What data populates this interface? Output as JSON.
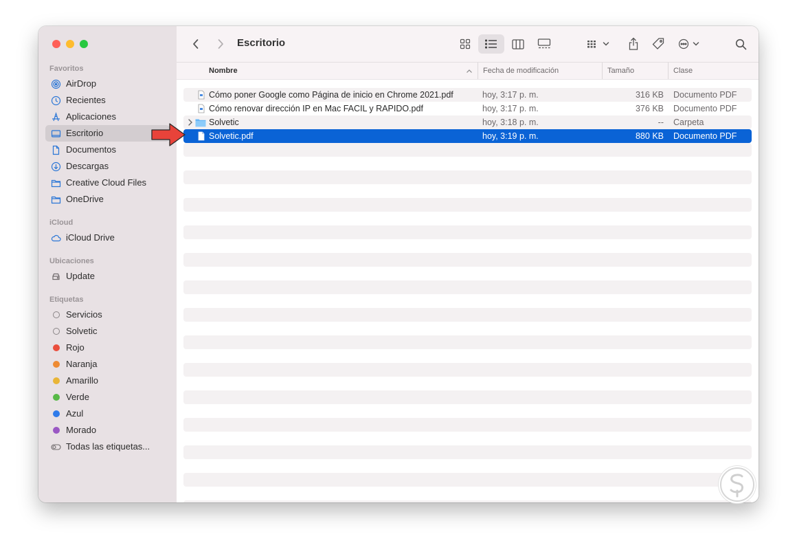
{
  "window": {
    "traffic_lights": {
      "close": "#fe5f57",
      "minimize": "#febc2e",
      "zoom": "#28c840"
    }
  },
  "sidebar": {
    "favorites_heading": "Favoritos",
    "favorites": [
      {
        "label": "AirDrop",
        "icon": "airdrop-icon"
      },
      {
        "label": "Recientes",
        "icon": "clock-icon"
      },
      {
        "label": "Aplicaciones",
        "icon": "applications-icon"
      },
      {
        "label": "Escritorio",
        "icon": "desktop-icon",
        "selected": true
      },
      {
        "label": "Documentos",
        "icon": "document-icon"
      },
      {
        "label": "Descargas",
        "icon": "download-icon"
      },
      {
        "label": "Creative Cloud Files",
        "icon": "folder-icon"
      },
      {
        "label": "OneDrive",
        "icon": "folder-icon"
      }
    ],
    "icloud_heading": "iCloud",
    "icloud": [
      {
        "label": "iCloud Drive",
        "icon": "cloud-icon"
      }
    ],
    "locations_heading": "Ubicaciones",
    "locations": [
      {
        "label": "Update",
        "icon": "disk-icon"
      }
    ],
    "tags_heading": "Etiquetas",
    "tags": [
      {
        "label": "Servicios",
        "color": ""
      },
      {
        "label": "Solvetic",
        "color": ""
      },
      {
        "label": "Rojo",
        "color": "#ea4e3d"
      },
      {
        "label": "Naranja",
        "color": "#ee8a33"
      },
      {
        "label": "Amarillo",
        "color": "#e9b537"
      },
      {
        "label": "Verde",
        "color": "#58b947"
      },
      {
        "label": "Azul",
        "color": "#2f7bea"
      },
      {
        "label": "Morado",
        "color": "#9a58c4"
      },
      {
        "label": "Todas las etiquetas...",
        "color": "all"
      }
    ]
  },
  "toolbar": {
    "title": "Escritorio",
    "back_icon": "chevron-left-icon",
    "forward_icon": "chevron-right-icon",
    "views": [
      "icon-view-icon",
      "list-view-icon",
      "column-view-icon",
      "gallery-view-icon"
    ],
    "active_view": "list-view-icon"
  },
  "columns": {
    "name": "Nombre",
    "date": "Fecha de modificación",
    "size": "Tamaño",
    "kind": "Clase"
  },
  "files": [
    {
      "name": "Cómo poner Google como Página de inicio en Chrome 2021.pdf",
      "date": "hoy, 3:17 p. m.",
      "size": "316 KB",
      "kind": "Documento PDF",
      "type": "pdf"
    },
    {
      "name": "Cómo renovar dirección IP en Mac  FACIL y RAPIDO.pdf",
      "date": "hoy, 3:17 p. m.",
      "size": "376 KB",
      "kind": "Documento PDF",
      "type": "pdf"
    },
    {
      "name": "Solvetic",
      "date": "hoy, 3:18 p. m.",
      "size": "--",
      "kind": "Carpeta",
      "type": "folder"
    },
    {
      "name": "Solvetic.pdf",
      "date": "hoy, 3:19 p. m.",
      "size": "880 KB",
      "kind": "Documento PDF",
      "type": "pdf",
      "selected": true
    }
  ],
  "selection_color": "#0a63d6",
  "annotation_arrow_color": "#e8433a"
}
